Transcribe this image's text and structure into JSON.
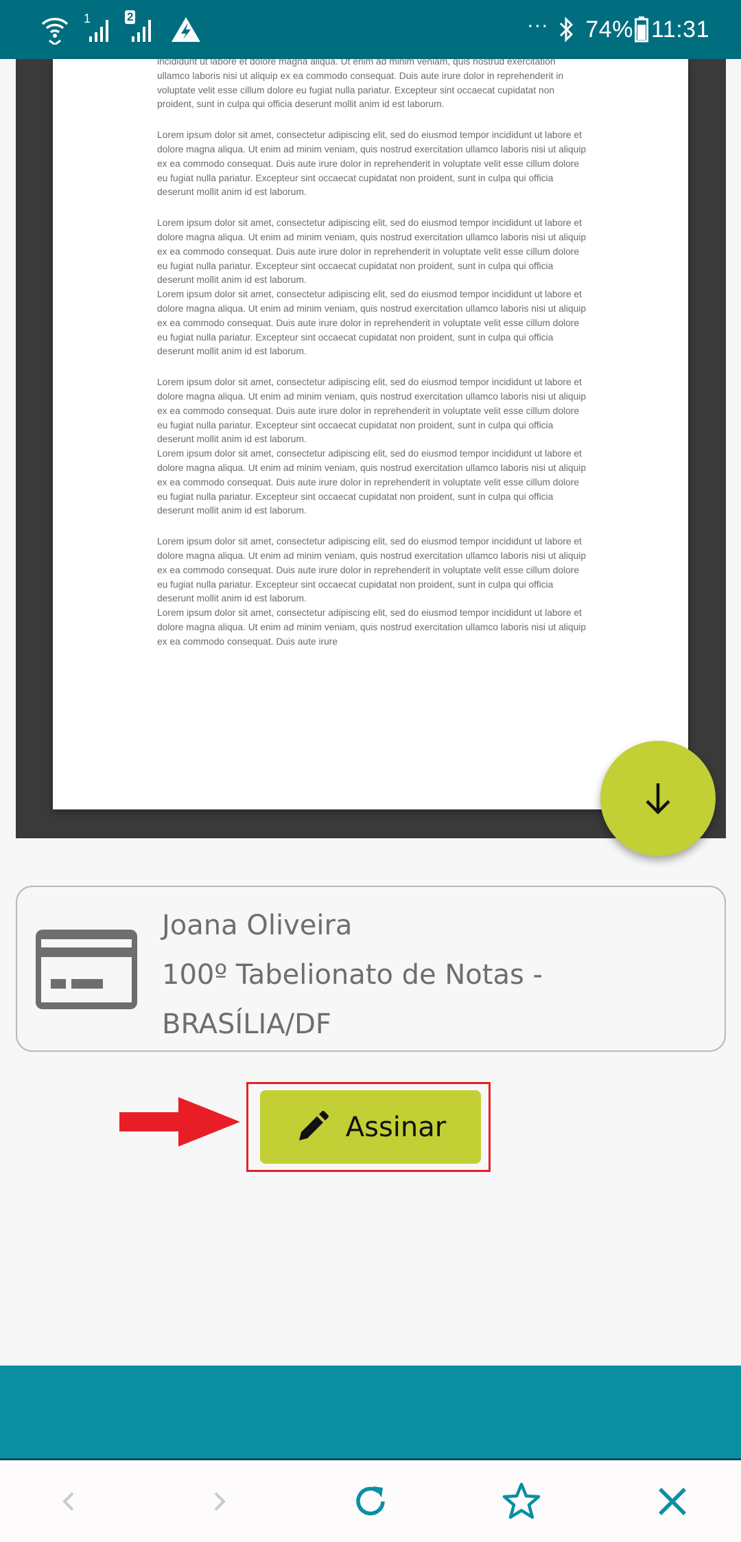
{
  "status_bar": {
    "sim1_label": "1",
    "sim2_label": "2",
    "overflow": "···",
    "battery": "74%",
    "time": "11:31"
  },
  "document": {
    "paragraphs": [
      "incididunt ut labore et dolore magna aliqua. Ut enim ad minim veniam, quis nostrud exercitation ullamco laboris nisi ut aliquip ex ea commodo consequat. Duis aute irure dolor in reprehenderit in voluptate velit esse cillum dolore eu fugiat nulla pariatur. Excepteur sint occaecat cupidatat non proident, sunt in culpa qui officia deserunt mollit anim id est laborum.",
      "Lorem ipsum dolor sit amet, consectetur adipiscing elit, sed do eiusmod tempor incididunt ut labore et dolore magna aliqua. Ut enim ad minim veniam, quis nostrud exercitation ullamco laboris nisi ut aliquip ex ea commodo consequat. Duis aute irure dolor in reprehenderit in voluptate velit esse cillum dolore eu fugiat nulla pariatur. Excepteur sint occaecat cupidatat non proident, sunt in culpa qui officia deserunt mollit anim id est laborum.",
      "Lorem ipsum dolor sit amet, consectetur adipiscing elit, sed do eiusmod tempor incididunt ut labore et dolore magna aliqua. Ut enim ad minim veniam, quis nostrud exercitation ullamco laboris nisi ut aliquip ex ea commodo consequat. Duis aute irure dolor in reprehenderit in voluptate velit esse cillum dolore eu fugiat nulla pariatur. Excepteur sint occaecat cupidatat non proident, sunt in culpa qui officia deserunt mollit anim id est laborum.",
      "Lorem ipsum dolor sit amet, consectetur adipiscing elit, sed do eiusmod tempor incididunt ut labore et dolore magna aliqua. Ut enim ad minim veniam, quis nostrud exercitation ullamco laboris nisi ut aliquip ex ea commodo consequat. Duis aute irure dolor in reprehenderit in voluptate velit esse cillum dolore eu fugiat nulla pariatur. Excepteur sint occaecat cupidatat non proident, sunt in culpa qui officia deserunt mollit anim id est laborum.",
      "Lorem ipsum dolor sit amet, consectetur adipiscing elit, sed do eiusmod tempor incididunt ut labore et dolore magna aliqua. Ut enim ad minim veniam, quis nostrud exercitation ullamco laboris nisi ut aliquip ex ea commodo consequat. Duis aute irure dolor in reprehenderit in voluptate velit esse cillum dolore eu fugiat nulla pariatur. Excepteur sint occaecat cupidatat non proident, sunt in culpa qui officia deserunt mollit anim id est laborum.",
      "Lorem ipsum dolor sit amet, consectetur adipiscing elit, sed do eiusmod tempor incididunt ut labore et dolore magna aliqua. Ut enim ad minim veniam, quis nostrud exercitation ullamco laboris nisi ut aliquip ex ea commodo consequat. Duis aute irure dolor in reprehenderit in voluptate velit esse cillum dolore eu fugiat nulla pariatur. Excepteur sint occaecat cupidatat non proident, sunt in culpa qui officia deserunt mollit anim id est laborum.",
      "Lorem ipsum dolor sit amet, consectetur adipiscing elit, sed do eiusmod tempor incididunt ut labore et dolore magna aliqua. Ut enim ad minim veniam, quis nostrud exercitation ullamco laboris nisi ut aliquip ex ea commodo consequat. Duis aute irure dolor in reprehenderit in voluptate velit esse cillum dolore eu fugiat nulla pariatur. Excepteur sint occaecat cupidatat non proident, sunt in culpa qui officia deserunt mollit anim id est laborum.",
      "Lorem ipsum dolor sit amet, consectetur adipiscing elit, sed do eiusmod tempor incididunt ut labore et dolore magna aliqua. Ut enim ad minim veniam, quis nostrud exercitation ullamco laboris nisi ut aliquip ex ea commodo consequat. Duis aute irure"
    ]
  },
  "signer": {
    "name": "Joana Oliveira",
    "office_line1": "100º Tabelionato de Notas -",
    "office_line2": "BRASÍLIA/DF"
  },
  "actions": {
    "sign_label": "Assinar"
  },
  "colors": {
    "status_bar": "#006e7f",
    "accent": "#c2cf35",
    "band": "#0a8fa3",
    "highlight": "#e0232a",
    "toolbar_icon": "#0a8fa3"
  },
  "icons": {
    "download": "arrow-down-icon",
    "card": "credit-card-icon",
    "sign": "pen-icon",
    "toolbar": [
      "back-icon",
      "forward-icon",
      "reload-icon",
      "star-icon",
      "close-icon"
    ]
  }
}
